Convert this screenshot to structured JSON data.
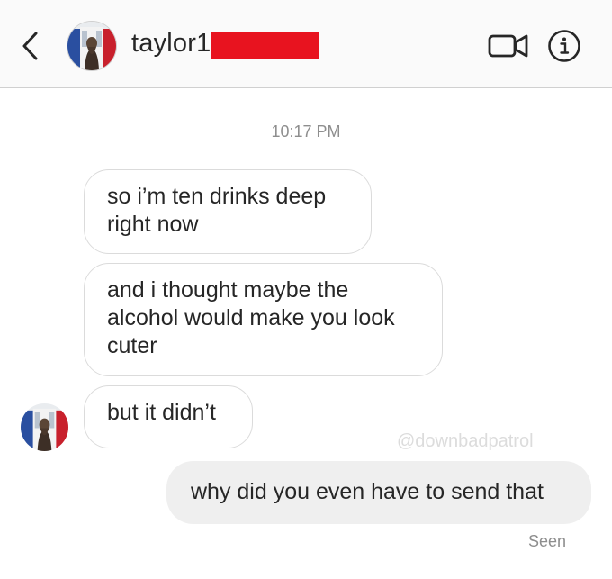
{
  "header": {
    "username": "taylor1",
    "avatar_icon": "profile-avatar-icon",
    "back_icon": "chevron-left-icon",
    "video_call_icon": "video-camera-icon",
    "info_icon": "info-icon",
    "redaction_color": "#e8131f"
  },
  "thread": {
    "timestamp": "10:17 PM",
    "messages": [
      {
        "sender": "them",
        "text": "so i’m ten drinks deep right now"
      },
      {
        "sender": "them",
        "text": "and i thought maybe the alcohol would make you look cuter"
      },
      {
        "sender": "them",
        "text": "but it didn’t"
      },
      {
        "sender": "me",
        "text": "why did you even have to send that"
      }
    ],
    "watermark": "@downbadpatrol",
    "seen_label": "Seen"
  },
  "colors": {
    "header_bg": "#fafafa",
    "incoming_border": "#dbdbdb",
    "outgoing_bg": "#efefef",
    "meta_text": "#8e8e8e"
  }
}
